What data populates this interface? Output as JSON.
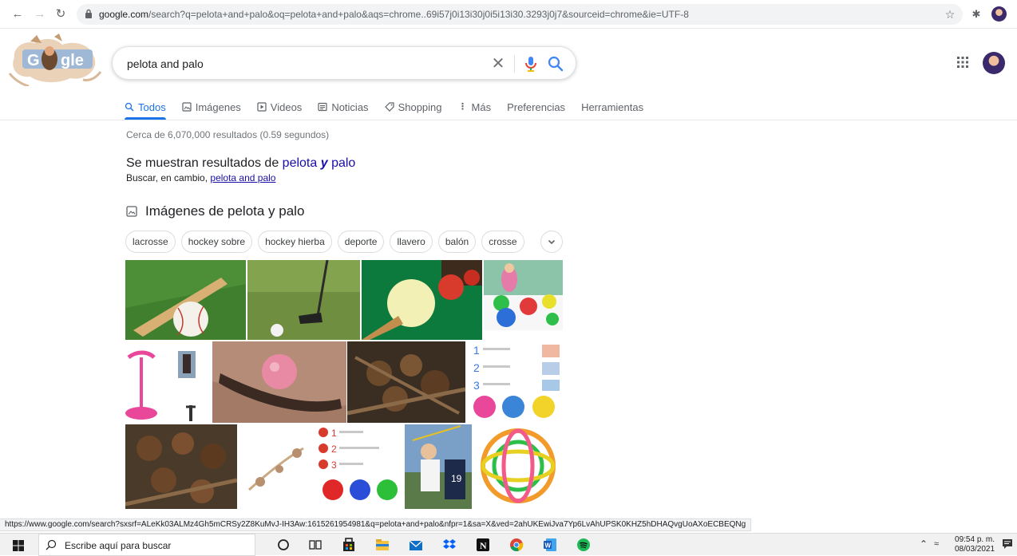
{
  "browser": {
    "url_prefix": "google.com",
    "url_rest": "/search?q=pelota+and+palo&oq=pelota+and+palo&aqs=chrome..69i57j0i13i30j0i5i13i30.3293j0j7&sourceid=chrome&ie=UTF-8"
  },
  "search": {
    "query": "pelota and palo"
  },
  "tabs": [
    {
      "label": "Todos",
      "icon": "search-icon"
    },
    {
      "label": "Imágenes",
      "icon": "image-icon"
    },
    {
      "label": "Videos",
      "icon": "video-icon"
    },
    {
      "label": "Noticias",
      "icon": "news-icon"
    },
    {
      "label": "Shopping",
      "icon": "tag-icon"
    },
    {
      "label": "Más",
      "icon": "more-vert-icon"
    },
    {
      "label": "Preferencias"
    },
    {
      "label": "Herramientas"
    }
  ],
  "results": {
    "stats": "Cerca de 6,070,000 resultados (0.59 segundos)",
    "showing_prefix": "Se muestran resultados de ",
    "showing_w1": "pelota",
    "showing_w2": "y",
    "showing_w3": "palo",
    "instead_prefix": "Buscar, en cambio, ",
    "instead_link": "pelota and palo"
  },
  "images": {
    "header": "Imágenes de pelota y palo",
    "chips": [
      "lacrosse",
      "hockey sobre",
      "hockey hierba",
      "deporte",
      "llavero",
      "balón",
      "crosse"
    ]
  },
  "status_url": "https://www.google.com/search?sxsrf=ALeKk03ALMz4Gh5mCRSy2Z8KuMvJ-IH3Aw:1615261954981&q=pelota+and+palo&nfpr=1&sa=X&ved=2ahUKEwiJva7Yp6LvAhUPSK0KHZ5hDHAQvgUoAXoECBEQNg",
  "taskbar": {
    "search_placeholder": "Escribe aquí para buscar",
    "time": "09:54 p. m.",
    "date": "08/03/2021"
  },
  "colors": {
    "accent": "#1a73e8",
    "link": "#1a0dab"
  }
}
